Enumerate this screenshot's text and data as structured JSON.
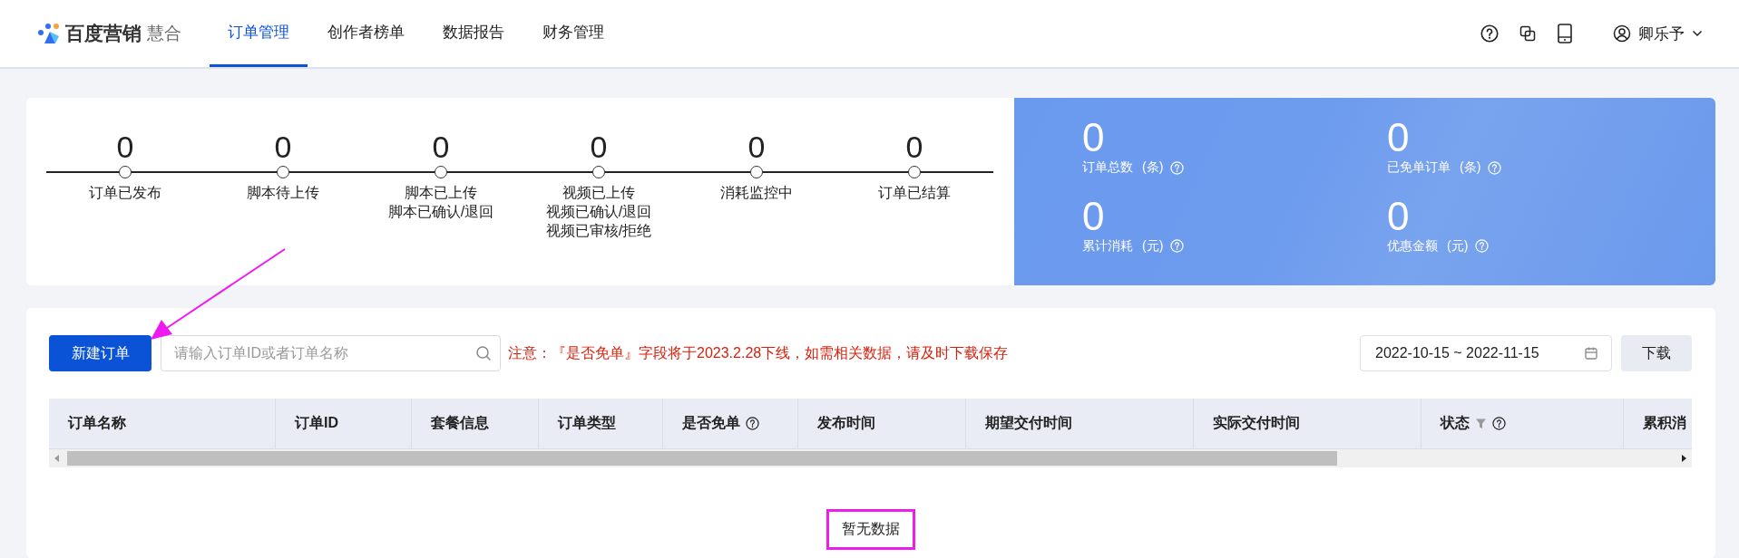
{
  "header": {
    "logo": {
      "brand": "百度营销",
      "product": "慧合"
    },
    "tabs": [
      {
        "label": "订单管理",
        "selected": true
      },
      {
        "label": "创作者榜单",
        "selected": false
      },
      {
        "label": "数据报告",
        "selected": false
      },
      {
        "label": "财务管理",
        "selected": false
      }
    ],
    "user": {
      "name": "卿乐予"
    }
  },
  "progress": {
    "steps": [
      {
        "count": "0",
        "labels": [
          "订单已发布"
        ]
      },
      {
        "count": "0",
        "labels": [
          "脚本待上传"
        ]
      },
      {
        "count": "0",
        "labels": [
          "脚本已上传",
          "脚本已确认/退回"
        ]
      },
      {
        "count": "0",
        "labels": [
          "视频已上传",
          "视频已确认/退回",
          "视频已审核/拒绝"
        ]
      },
      {
        "count": "0",
        "labels": [
          "消耗监控中"
        ]
      },
      {
        "count": "0",
        "labels": [
          "订单已结算"
        ]
      }
    ]
  },
  "summary": [
    {
      "value": "0",
      "label": "订单总数",
      "unit": "(条)"
    },
    {
      "value": "0",
      "label": "已免单订单",
      "unit": "(条)"
    },
    {
      "value": "0",
      "label": "累计消耗",
      "unit": "(元)"
    },
    {
      "value": "0",
      "label": "优惠金额",
      "unit": "(元)"
    }
  ],
  "toolbar": {
    "create_button": "新建订单",
    "search": {
      "placeholder": "请输入订单ID或者订单名称"
    },
    "notice": "注意：『是否免单』字段将于2023.2.28下线，如需相关数据，请及时下载保存",
    "date_range": "2022-10-15 ~ 2022-11-15",
    "download_button": "下载"
  },
  "table": {
    "columns": [
      {
        "label": "订单名称",
        "help": false,
        "filter": false
      },
      {
        "label": "订单ID",
        "help": false,
        "filter": false
      },
      {
        "label": "套餐信息",
        "help": false,
        "filter": false
      },
      {
        "label": "订单类型",
        "help": false,
        "filter": false
      },
      {
        "label": "是否免单",
        "help": true,
        "filter": false
      },
      {
        "label": "发布时间",
        "help": false,
        "filter": false
      },
      {
        "label": "期望交付时间",
        "help": false,
        "filter": false
      },
      {
        "label": "实际交付时间",
        "help": false,
        "filter": false
      },
      {
        "label": "状态",
        "help": true,
        "filter": true
      },
      {
        "label": "累积消"
      }
    ],
    "empty_text": "暂无数据"
  },
  "annotations": {
    "arrow": true,
    "highlight_box": true
  }
}
